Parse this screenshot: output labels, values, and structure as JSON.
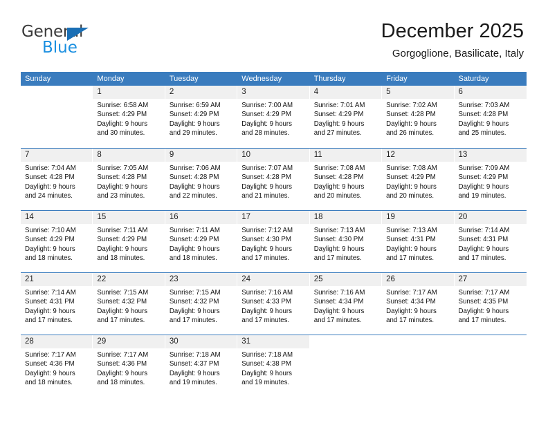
{
  "brand": {
    "name_top": "General",
    "name_bottom": "Blue",
    "accent_blue": "#1a8fe0",
    "triangle_blue": "#1a6fb5"
  },
  "header": {
    "title": "December 2025",
    "subtitle": "Gorgoglione, Basilicate, Italy"
  },
  "calendar": {
    "header_bg": "#3a7cbe",
    "daynum_bg": "#f0f0f0",
    "weekday_headers": [
      "Sunday",
      "Monday",
      "Tuesday",
      "Wednesday",
      "Thursday",
      "Friday",
      "Saturday"
    ],
    "weeks": [
      [
        {
          "day": "",
          "sunrise": "",
          "sunset": "",
          "daylight_line1": "",
          "daylight_line2": ""
        },
        {
          "day": "1",
          "sunrise": "Sunrise: 6:58 AM",
          "sunset": "Sunset: 4:29 PM",
          "daylight_line1": "Daylight: 9 hours",
          "daylight_line2": "and 30 minutes."
        },
        {
          "day": "2",
          "sunrise": "Sunrise: 6:59 AM",
          "sunset": "Sunset: 4:29 PM",
          "daylight_line1": "Daylight: 9 hours",
          "daylight_line2": "and 29 minutes."
        },
        {
          "day": "3",
          "sunrise": "Sunrise: 7:00 AM",
          "sunset": "Sunset: 4:29 PM",
          "daylight_line1": "Daylight: 9 hours",
          "daylight_line2": "and 28 minutes."
        },
        {
          "day": "4",
          "sunrise": "Sunrise: 7:01 AM",
          "sunset": "Sunset: 4:29 PM",
          "daylight_line1": "Daylight: 9 hours",
          "daylight_line2": "and 27 minutes."
        },
        {
          "day": "5",
          "sunrise": "Sunrise: 7:02 AM",
          "sunset": "Sunset: 4:28 PM",
          "daylight_line1": "Daylight: 9 hours",
          "daylight_line2": "and 26 minutes."
        },
        {
          "day": "6",
          "sunrise": "Sunrise: 7:03 AM",
          "sunset": "Sunset: 4:28 PM",
          "daylight_line1": "Daylight: 9 hours",
          "daylight_line2": "and 25 minutes."
        }
      ],
      [
        {
          "day": "7",
          "sunrise": "Sunrise: 7:04 AM",
          "sunset": "Sunset: 4:28 PM",
          "daylight_line1": "Daylight: 9 hours",
          "daylight_line2": "and 24 minutes."
        },
        {
          "day": "8",
          "sunrise": "Sunrise: 7:05 AM",
          "sunset": "Sunset: 4:28 PM",
          "daylight_line1": "Daylight: 9 hours",
          "daylight_line2": "and 23 minutes."
        },
        {
          "day": "9",
          "sunrise": "Sunrise: 7:06 AM",
          "sunset": "Sunset: 4:28 PM",
          "daylight_line1": "Daylight: 9 hours",
          "daylight_line2": "and 22 minutes."
        },
        {
          "day": "10",
          "sunrise": "Sunrise: 7:07 AM",
          "sunset": "Sunset: 4:28 PM",
          "daylight_line1": "Daylight: 9 hours",
          "daylight_line2": "and 21 minutes."
        },
        {
          "day": "11",
          "sunrise": "Sunrise: 7:08 AM",
          "sunset": "Sunset: 4:28 PM",
          "daylight_line1": "Daylight: 9 hours",
          "daylight_line2": "and 20 minutes."
        },
        {
          "day": "12",
          "sunrise": "Sunrise: 7:08 AM",
          "sunset": "Sunset: 4:29 PM",
          "daylight_line1": "Daylight: 9 hours",
          "daylight_line2": "and 20 minutes."
        },
        {
          "day": "13",
          "sunrise": "Sunrise: 7:09 AM",
          "sunset": "Sunset: 4:29 PM",
          "daylight_line1": "Daylight: 9 hours",
          "daylight_line2": "and 19 minutes."
        }
      ],
      [
        {
          "day": "14",
          "sunrise": "Sunrise: 7:10 AM",
          "sunset": "Sunset: 4:29 PM",
          "daylight_line1": "Daylight: 9 hours",
          "daylight_line2": "and 18 minutes."
        },
        {
          "day": "15",
          "sunrise": "Sunrise: 7:11 AM",
          "sunset": "Sunset: 4:29 PM",
          "daylight_line1": "Daylight: 9 hours",
          "daylight_line2": "and 18 minutes."
        },
        {
          "day": "16",
          "sunrise": "Sunrise: 7:11 AM",
          "sunset": "Sunset: 4:29 PM",
          "daylight_line1": "Daylight: 9 hours",
          "daylight_line2": "and 18 minutes."
        },
        {
          "day": "17",
          "sunrise": "Sunrise: 7:12 AM",
          "sunset": "Sunset: 4:30 PM",
          "daylight_line1": "Daylight: 9 hours",
          "daylight_line2": "and 17 minutes."
        },
        {
          "day": "18",
          "sunrise": "Sunrise: 7:13 AM",
          "sunset": "Sunset: 4:30 PM",
          "daylight_line1": "Daylight: 9 hours",
          "daylight_line2": "and 17 minutes."
        },
        {
          "day": "19",
          "sunrise": "Sunrise: 7:13 AM",
          "sunset": "Sunset: 4:31 PM",
          "daylight_line1": "Daylight: 9 hours",
          "daylight_line2": "and 17 minutes."
        },
        {
          "day": "20",
          "sunrise": "Sunrise: 7:14 AM",
          "sunset": "Sunset: 4:31 PM",
          "daylight_line1": "Daylight: 9 hours",
          "daylight_line2": "and 17 minutes."
        }
      ],
      [
        {
          "day": "21",
          "sunrise": "Sunrise: 7:14 AM",
          "sunset": "Sunset: 4:31 PM",
          "daylight_line1": "Daylight: 9 hours",
          "daylight_line2": "and 17 minutes."
        },
        {
          "day": "22",
          "sunrise": "Sunrise: 7:15 AM",
          "sunset": "Sunset: 4:32 PM",
          "daylight_line1": "Daylight: 9 hours",
          "daylight_line2": "and 17 minutes."
        },
        {
          "day": "23",
          "sunrise": "Sunrise: 7:15 AM",
          "sunset": "Sunset: 4:32 PM",
          "daylight_line1": "Daylight: 9 hours",
          "daylight_line2": "and 17 minutes."
        },
        {
          "day": "24",
          "sunrise": "Sunrise: 7:16 AM",
          "sunset": "Sunset: 4:33 PM",
          "daylight_line1": "Daylight: 9 hours",
          "daylight_line2": "and 17 minutes."
        },
        {
          "day": "25",
          "sunrise": "Sunrise: 7:16 AM",
          "sunset": "Sunset: 4:34 PM",
          "daylight_line1": "Daylight: 9 hours",
          "daylight_line2": "and 17 minutes."
        },
        {
          "day": "26",
          "sunrise": "Sunrise: 7:17 AM",
          "sunset": "Sunset: 4:34 PM",
          "daylight_line1": "Daylight: 9 hours",
          "daylight_line2": "and 17 minutes."
        },
        {
          "day": "27",
          "sunrise": "Sunrise: 7:17 AM",
          "sunset": "Sunset: 4:35 PM",
          "daylight_line1": "Daylight: 9 hours",
          "daylight_line2": "and 17 minutes."
        }
      ],
      [
        {
          "day": "28",
          "sunrise": "Sunrise: 7:17 AM",
          "sunset": "Sunset: 4:36 PM",
          "daylight_line1": "Daylight: 9 hours",
          "daylight_line2": "and 18 minutes."
        },
        {
          "day": "29",
          "sunrise": "Sunrise: 7:17 AM",
          "sunset": "Sunset: 4:36 PM",
          "daylight_line1": "Daylight: 9 hours",
          "daylight_line2": "and 18 minutes."
        },
        {
          "day": "30",
          "sunrise": "Sunrise: 7:18 AM",
          "sunset": "Sunset: 4:37 PM",
          "daylight_line1": "Daylight: 9 hours",
          "daylight_line2": "and 19 minutes."
        },
        {
          "day": "31",
          "sunrise": "Sunrise: 7:18 AM",
          "sunset": "Sunset: 4:38 PM",
          "daylight_line1": "Daylight: 9 hours",
          "daylight_line2": "and 19 minutes."
        },
        {
          "day": "",
          "sunrise": "",
          "sunset": "",
          "daylight_line1": "",
          "daylight_line2": ""
        },
        {
          "day": "",
          "sunrise": "",
          "sunset": "",
          "daylight_line1": "",
          "daylight_line2": ""
        },
        {
          "day": "",
          "sunrise": "",
          "sunset": "",
          "daylight_line1": "",
          "daylight_line2": ""
        }
      ]
    ]
  }
}
